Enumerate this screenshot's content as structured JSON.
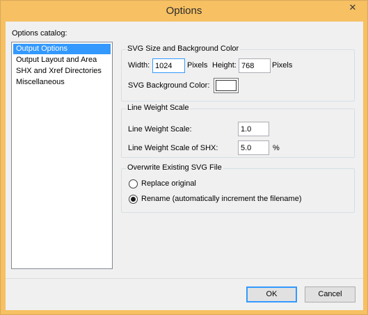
{
  "window": {
    "title": "Options",
    "close_glyph": "✕"
  },
  "catalog": {
    "label": "Options catalog:",
    "items": [
      {
        "label": "Output Options",
        "selected": true
      },
      {
        "label": "Output Layout and Area",
        "selected": false
      },
      {
        "label": "SHX and Xref Directories",
        "selected": false
      },
      {
        "label": "Miscellaneous",
        "selected": false
      }
    ]
  },
  "svg_size": {
    "title": "SVG Size and Background Color",
    "width_label": "Width:",
    "width_value": "1024",
    "width_unit": "Pixels",
    "height_label": "Height:",
    "height_value": "768",
    "height_unit": "Pixels",
    "bg_label": "SVG Background Color:",
    "bg_color": "#ffffff"
  },
  "line_weight": {
    "title": "Line Weight Scale",
    "scale_label": "Line Weight Scale:",
    "scale_value": "1.0",
    "shx_label": "Line Weight Scale of SHX:",
    "shx_value": "5.0",
    "shx_unit": "%"
  },
  "overwrite": {
    "title": "Overwrite Existing SVG File",
    "options": [
      {
        "label": "Replace original",
        "checked": false
      },
      {
        "label": "Rename (automatically increment the filename)",
        "checked": true
      }
    ]
  },
  "buttons": {
    "ok": "OK",
    "cancel": "Cancel"
  },
  "colors": {
    "titlebar": "#f6c063",
    "selection": "#3399ff"
  }
}
